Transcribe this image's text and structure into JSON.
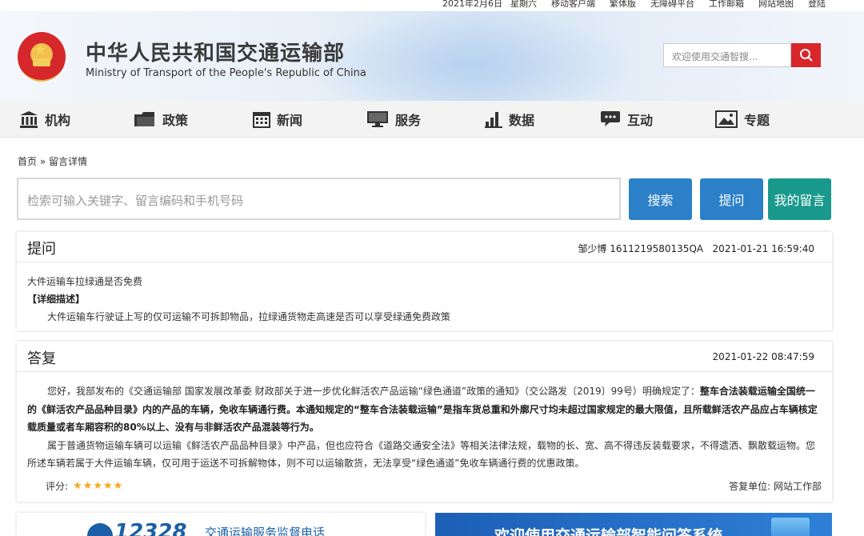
{
  "topbar": {
    "date": "2021年2月6日",
    "weekday": "星期六",
    "links": [
      "移动客户端",
      "繁体版",
      "无障碍平台",
      "工作邮箱",
      "网站地图",
      "登陆"
    ]
  },
  "header": {
    "title_cn": "中华人民共和国交通运输部",
    "title_en": "Ministry of Transport of the People's Republic of China",
    "search_placeholder": "欢迎使用交通智搜...",
    "colors": {
      "search_button": "#d9262b"
    }
  },
  "nav": {
    "items": [
      {
        "label": "机构",
        "icon": "institution-icon"
      },
      {
        "label": "政策",
        "icon": "folder-icon"
      },
      {
        "label": "新闻",
        "icon": "calendar-icon"
      },
      {
        "label": "服务",
        "icon": "monitor-icon"
      },
      {
        "label": "数据",
        "icon": "bar-chart-icon"
      },
      {
        "label": "互动",
        "icon": "chat-bubble-icon"
      },
      {
        "label": "专题",
        "icon": "picture-icon"
      }
    ]
  },
  "breadcrumb": {
    "home": "首页",
    "separator": "»",
    "current": "留言详情"
  },
  "search": {
    "placeholder": "检索可输入关键字、留言编码和手机号码",
    "search_label": "搜索",
    "ask_label": "提问",
    "my_messages_label": "我的留言",
    "colors": {
      "blue": "#2b80c8",
      "teal": "#19998c"
    }
  },
  "question": {
    "heading": "提问",
    "author": "邹少博",
    "code": "1611219580135QA",
    "datetime": "2021-01-21 16:59:40",
    "title": "大件运输车拉绿通是否免费",
    "detail_label": "【详细描述】",
    "detail": "大件运输车行驶证上写的仅可运输不可拆卸物品，拉绿通货物走高速是否可以享受绿通免费政策"
  },
  "answer": {
    "heading": "答复",
    "datetime": "2021-01-22 08:47:59",
    "p1_normal": "您好，我部发布的《交通运输部 国家发展改革委 财政部关于进一步优化鲜活农产品运输“绿色通道”政策的通知》（交公路发〔2019〕99号）明确规定了：",
    "p1_bold": "整车合法装载运输全国统一的《鲜活农产品品种目录》内的产品的车辆，免收车辆通行费。本通知规定的“整车合法装载运输”是指车货总重和外廓尺寸均未超过国家规定的最大限值，且所载鲜活农产品应占车辆核定载质量或者车厢容积的80%以上、没有与非鲜活农产品混装等行为。",
    "p2": "属于普通货物运输车辆可以运输《鲜活农产品品种目录》中产品，但也应符合《道路交通安全法》等相关法律法规，载物的长、宽、高不得违反装载要求，不得遗洒、飘散载运物。您所述车辆若属于大件运输车辆，仅可用于运送不可拆解物体，则不可以运输散货，无法享受“绿色通道”免收车辆通行费的优惠政策。",
    "rating_label": "评分:",
    "rating_stars": "★★★★★",
    "rating": 5,
    "unit_label": "答复单位:",
    "unit": "网站工作部"
  },
  "banners": {
    "left_number": "12328",
    "left_text": "交通运输服务监督电话",
    "right_text": "欢迎使用交通运输部智能问答系统"
  }
}
